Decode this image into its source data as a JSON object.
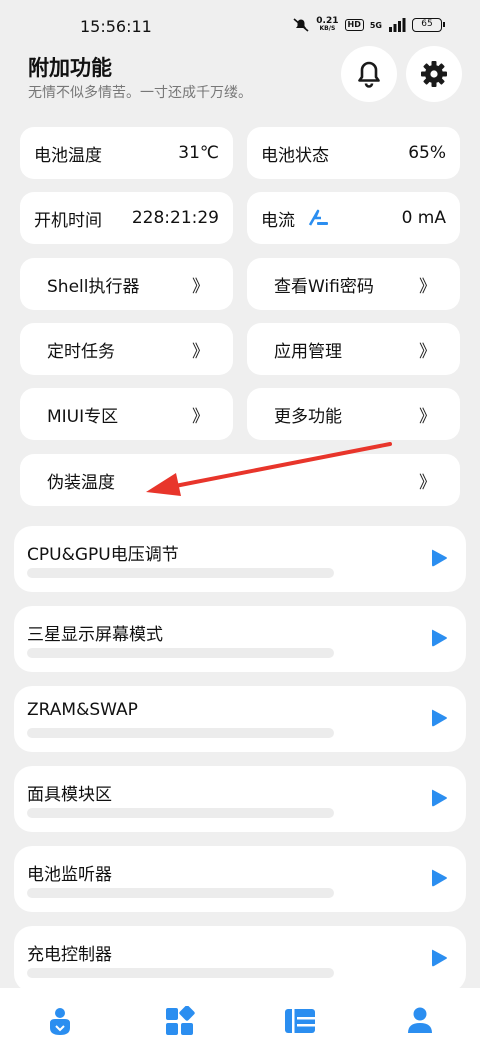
{
  "status_bar": {
    "time": "15:56:11",
    "net_speed_value": "0.21",
    "net_speed_unit": "KB/S",
    "hd_label": "HD",
    "network_type": "5G",
    "battery": "65"
  },
  "header": {
    "title": "附加功能",
    "subtitle": "无情不似多情苦。一寸还成千万缕。"
  },
  "info_tiles": {
    "battery_temp_label": "电池温度",
    "battery_temp_value": "31℃",
    "battery_status_label": "电池状态",
    "battery_status_value": "65%",
    "uptime_label": "开机时间",
    "uptime_value": "228:21:29",
    "current_label": "电流",
    "current_value": "0 mA"
  },
  "nav_tiles": [
    {
      "label": "Shell执行器",
      "chevron": "》"
    },
    {
      "label": "查看Wifi密码",
      "chevron": "》"
    },
    {
      "label": "定时任务",
      "chevron": "》"
    },
    {
      "label": "应用管理",
      "chevron": "》"
    },
    {
      "label": "MIUI专区",
      "chevron": "》"
    },
    {
      "label": "更多功能",
      "chevron": "》"
    },
    {
      "label": "伪装温度",
      "chevron": "》"
    }
  ],
  "cards": [
    {
      "title": "CPU&GPU电压调节"
    },
    {
      "title": "三星显示屏幕模式"
    },
    {
      "title": "ZRAM&SWAP"
    },
    {
      "title": "面具模块区"
    },
    {
      "title": "电池监听器"
    },
    {
      "title": "充电控制器"
    }
  ],
  "colors": {
    "accent": "#2b8ef0",
    "background": "#efefef",
    "annotation_arrow": "#e8352b"
  },
  "icons": {
    "bell": "bell-icon",
    "settings": "gear-icon",
    "current": "charging-icon",
    "play": "play-icon",
    "bottom_nav": [
      "home-person-icon",
      "apps-grid-icon",
      "list-panel-icon",
      "user-profile-icon"
    ]
  }
}
